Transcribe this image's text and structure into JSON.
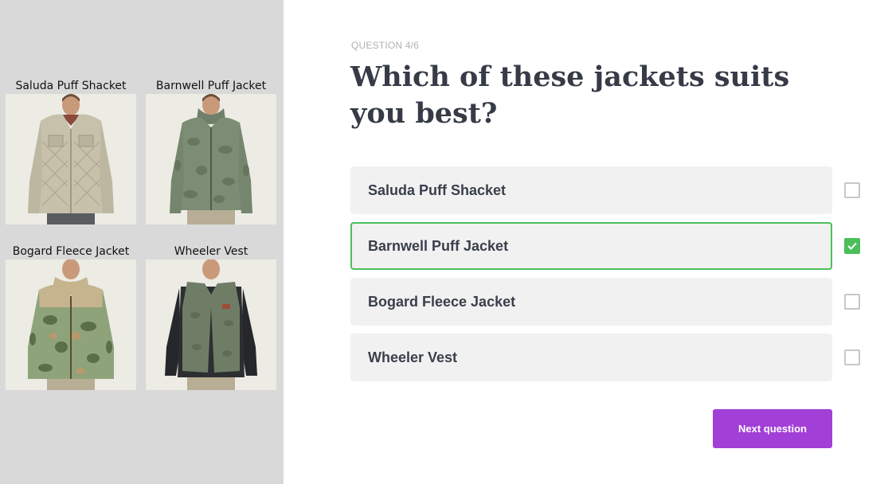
{
  "gallery": {
    "products": [
      {
        "name": "Saluda Puff Shacket"
      },
      {
        "name": "Barnwell Puff Jacket"
      },
      {
        "name": "Bogard Fleece Jacket"
      },
      {
        "name": "Wheeler Vest"
      }
    ]
  },
  "quiz": {
    "progress": "QUESTION 4/6",
    "question": "Which of these jackets suits you best?",
    "options": [
      {
        "label": "Saluda Puff Shacket",
        "checked": false
      },
      {
        "label": "Barnwell Puff Jacket",
        "checked": true
      },
      {
        "label": "Bogard Fleece Jacket",
        "checked": false
      },
      {
        "label": "Wheeler Vest",
        "checked": false
      }
    ],
    "next_label": "Next question"
  },
  "colors": {
    "accent": "#a23fd6",
    "selected": "#4cbf5a",
    "option_bg": "#f1f1f1",
    "panel_bg": "#d9d9d9"
  }
}
